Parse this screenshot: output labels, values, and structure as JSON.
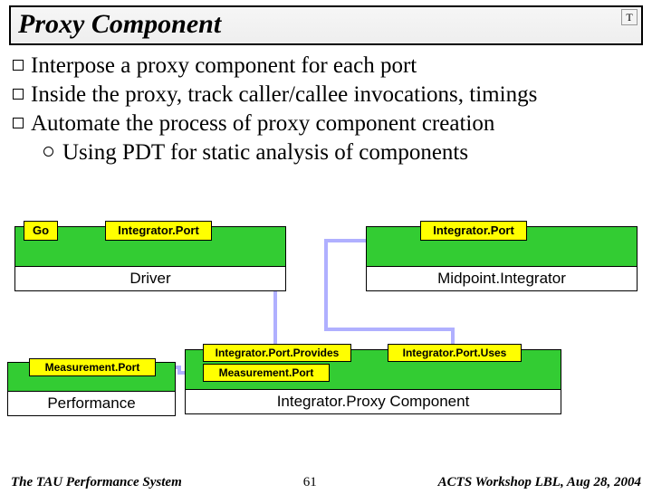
{
  "title": "Proxy Component",
  "logo_glyph": "T",
  "bullets": [
    "Interpose a proxy component for each port",
    "Inside the proxy, track caller/callee invocations, timings",
    "Automate the process of proxy component creation"
  ],
  "subbullet": "Using PDT for static analysis of components",
  "diagram": {
    "driver": {
      "label": "Driver",
      "go": "Go",
      "port": "Integrator.Port"
    },
    "midpoint": {
      "label": "Midpoint.Integrator",
      "port": "Integrator.Port"
    },
    "proxy": {
      "label": "Integrator.Proxy Component",
      "provides": "Integrator.Port.Provides",
      "uses": "Integrator.Port.Uses",
      "measurement": "Measurement.Port"
    },
    "performance": {
      "label": "Performance",
      "measurement": "Measurement.Port"
    }
  },
  "footer": {
    "left": "The TAU Performance System",
    "mid": "61",
    "right": "ACTS Workshop LBL, Aug 28, 2004"
  }
}
